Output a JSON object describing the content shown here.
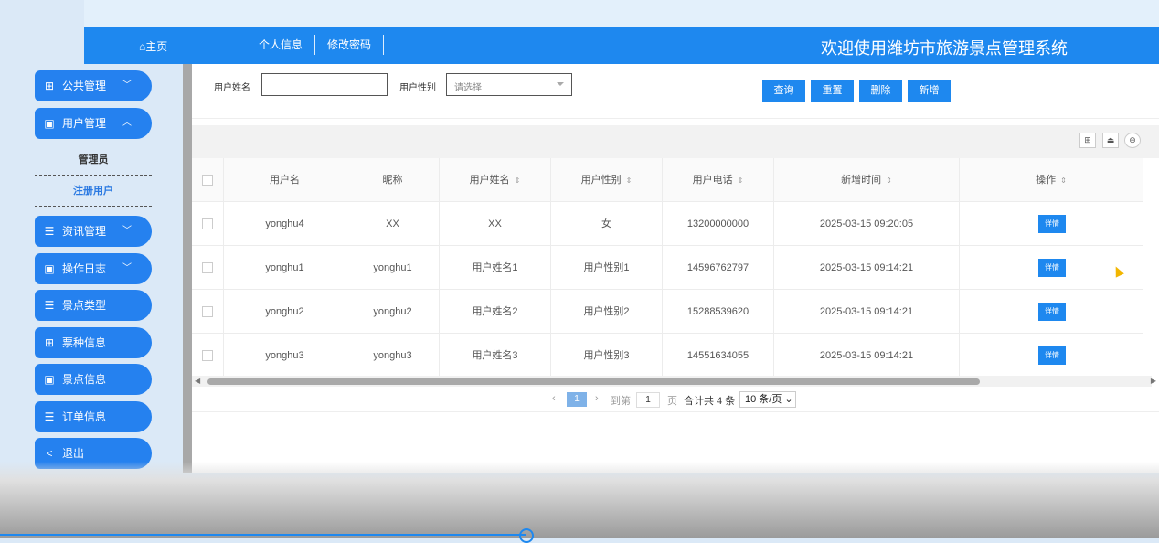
{
  "header": {
    "home_label": "⌂主页",
    "nav": [
      "个人信息",
      "修改密码"
    ],
    "title": "欢迎使用潍坊市旅游景点管理系统"
  },
  "sidebar": {
    "items": [
      {
        "label": "公共管理",
        "icon": "grid-icon",
        "chevron": "﹀"
      },
      {
        "label": "用户管理",
        "icon": "book-icon",
        "chevron": "︿"
      },
      {
        "label": "资讯管理",
        "icon": "list-icon",
        "chevron": "﹀"
      },
      {
        "label": "操作日志",
        "icon": "book-icon",
        "chevron": "﹀"
      },
      {
        "label": "景点类型",
        "icon": "list-icon"
      },
      {
        "label": "票种信息",
        "icon": "grid-icon"
      },
      {
        "label": "景点信息",
        "icon": "book-icon"
      },
      {
        "label": "订单信息",
        "icon": "list-icon"
      },
      {
        "label": "退出",
        "icon": "share-icon"
      }
    ],
    "submenu": [
      "管理员",
      "注册用户"
    ]
  },
  "search": {
    "name_label": "用户姓名",
    "name_value": "",
    "gender_label": "用户性别",
    "gender_placeholder": "请选择",
    "buttons": [
      "查询",
      "重置",
      "删除",
      "新增"
    ]
  },
  "table": {
    "headers": [
      "用户名",
      "昵称",
      "用户姓名",
      "用户性别",
      "用户电话",
      "新增时间",
      "操作"
    ],
    "rows": [
      [
        "yonghu4",
        "XX",
        "XX",
        "女",
        "13200000000",
        "2025-03-15 09:20:05"
      ],
      [
        "yonghu1",
        "yonghu1",
        "用户姓名1",
        "用户性别1",
        "14596762797",
        "2025-03-15 09:14:21"
      ],
      [
        "yonghu2",
        "yonghu2",
        "用户姓名2",
        "用户性别2",
        "15288539620",
        "2025-03-15 09:14:21"
      ],
      [
        "yonghu3",
        "yonghu3",
        "用户姓名3",
        "用户性别3",
        "14551634055",
        "2025-03-15 09:14:21"
      ]
    ],
    "action_label": "详情"
  },
  "pager": {
    "prev": "‹",
    "current": "1",
    "next": "›",
    "goto_label": "到第",
    "goto_value": "1",
    "page_unit": "页",
    "total": "合计共 4 条",
    "page_size": "10 条/页 ⌄"
  },
  "colors": {
    "primary": "#1e88ef",
    "background": "#dbe9f7"
  }
}
